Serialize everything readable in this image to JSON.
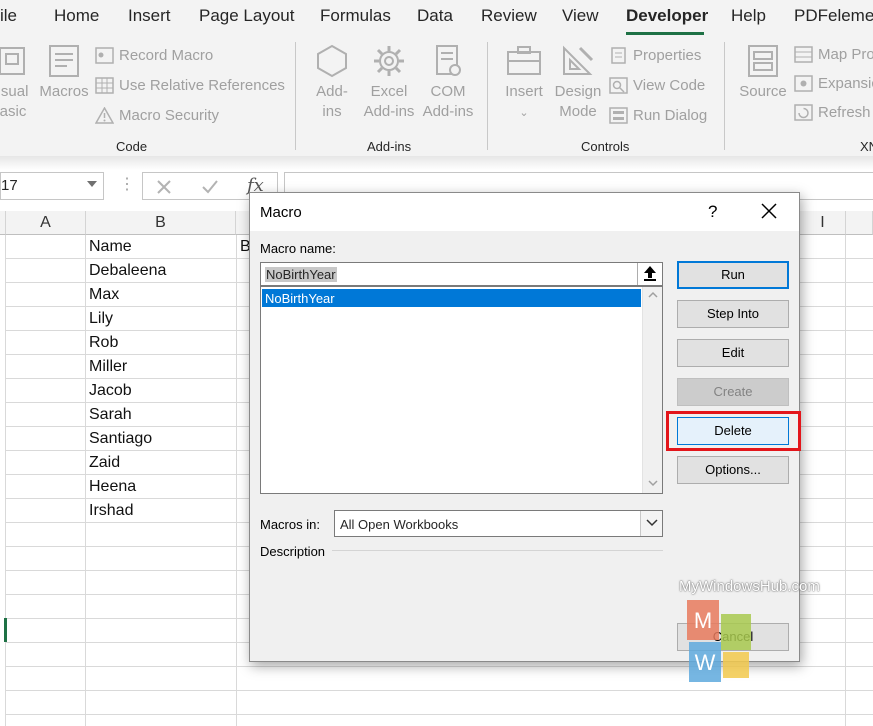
{
  "ribbon": {
    "tabs": [
      "ile",
      "Home",
      "Insert",
      "Page Layout",
      "Formulas",
      "Data",
      "Review",
      "View",
      "Developer",
      "Help",
      "PDFelemen"
    ],
    "active_tab": "Developer",
    "groups": {
      "code": {
        "label": "Code",
        "visual_basic": [
          "isual",
          "asic"
        ],
        "macros": "Macros",
        "record_macro": "Record Macro",
        "use_relative": "Use Relative References",
        "macro_security": "Macro Security"
      },
      "addins": {
        "label": "Add-ins",
        "addins": [
          "Add-",
          "ins"
        ],
        "excel_addins": [
          "Excel",
          "Add-ins"
        ],
        "com_addins": [
          "COM",
          "Add-ins"
        ]
      },
      "controls": {
        "label": "Controls",
        "insert": "Insert",
        "design_mode": [
          "Design",
          "Mode"
        ],
        "properties": "Properties",
        "view_code": "View Code",
        "run_dialog": "Run Dialog"
      },
      "xml": {
        "label": "XN",
        "source": "Source",
        "map_properties": "Map Pro",
        "expansion": "Expansic",
        "refresh": "Refresh"
      }
    }
  },
  "formula_bar": {
    "name_box": "17",
    "fx": "fx",
    "formula": ""
  },
  "sheet": {
    "columns": [
      "A",
      "B",
      "I"
    ],
    "b_partial": "B",
    "cells": [
      "Name",
      "Debaleena",
      "Max",
      "Lily",
      "Rob",
      "Miller",
      "Jacob",
      "Sarah",
      "Santiago",
      "Zaid",
      "Heena",
      "Irshad"
    ]
  },
  "dialog": {
    "title": "Macro",
    "help": "?",
    "macro_name_label": "Macro name:",
    "macro_name_value": "NoBirthYear",
    "list": [
      "NoBirthYear"
    ],
    "macros_in_label": "Macros in:",
    "macros_in_value": "All Open Workbooks",
    "description_label": "Description",
    "buttons": {
      "run": "Run",
      "step_into": "Step Into",
      "edit": "Edit",
      "create": "Create",
      "delete": "Delete",
      "options": "Options...",
      "cancel": "Cancel"
    }
  },
  "watermark": {
    "text": "MyWindowsHub.com",
    "logo_letters": [
      "M",
      "W"
    ]
  },
  "colors": {
    "accent_green": "#1e7145",
    "selection_blue": "#0078d7",
    "highlight_red": "#e3151a"
  }
}
